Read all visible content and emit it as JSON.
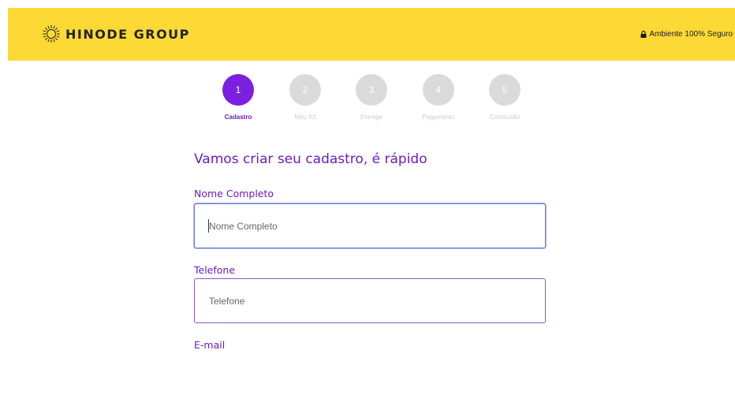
{
  "header": {
    "brand": "HINODE GROUP",
    "secure_text": "Ambiente 100% Seguro",
    "background_color": "#fdd935",
    "logo_icon": "sunburst-logo-icon",
    "secure_icon": "lock-icon"
  },
  "stepper": {
    "active_step": 1,
    "active_color": "#7b1fe0",
    "inactive_color": "#dadada",
    "steps": [
      {
        "number": "1",
        "label": "Cadastro"
      },
      {
        "number": "2",
        "label": "Meu Kit"
      },
      {
        "number": "3",
        "label": "Entrega"
      },
      {
        "number": "4",
        "label": "Pagamento"
      },
      {
        "number": "5",
        "label": "Conclusão"
      }
    ]
  },
  "form": {
    "title": "Vamos criar seu cadastro, é rápido",
    "accent_color": "#6a1bc4",
    "fields": [
      {
        "label": "Nome Completo",
        "placeholder": "Nome Completo",
        "value": ""
      },
      {
        "label": "Telefone",
        "placeholder": "Telefone",
        "value": ""
      },
      {
        "label": "E-mail"
      }
    ]
  }
}
